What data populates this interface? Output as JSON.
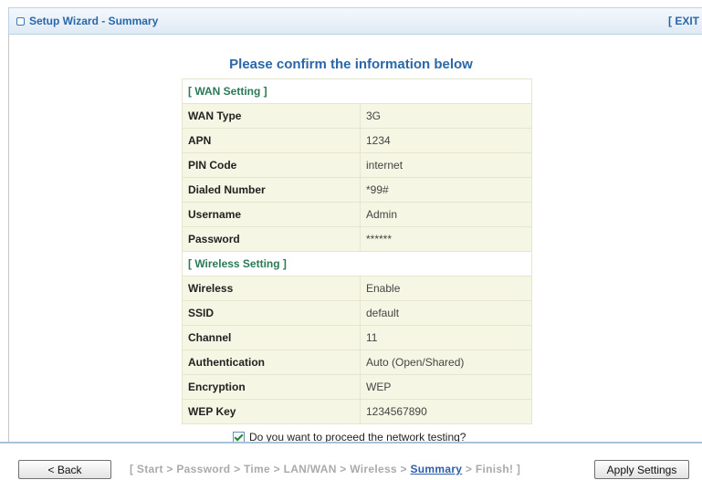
{
  "header": {
    "title": "Setup Wizard - Summary",
    "exit_label": "[ EXIT"
  },
  "heading": "Please confirm the information below",
  "wan_section": "[ WAN Setting ]",
  "wan_rows": [
    {
      "label": "WAN Type",
      "value": "3G"
    },
    {
      "label": "APN",
      "value": "1234"
    },
    {
      "label": "PIN Code",
      "value": "internet"
    },
    {
      "label": "Dialed Number",
      "value": "*99#"
    },
    {
      "label": "Username",
      "value": "Admin"
    },
    {
      "label": "Password",
      "value": "******"
    }
  ],
  "wireless_section": "[ Wireless Setting ]",
  "wireless_rows": [
    {
      "label": "Wireless",
      "value": "Enable"
    },
    {
      "label": "SSID",
      "value": "default"
    },
    {
      "label": "Channel",
      "value": "11"
    },
    {
      "label": "Authentication",
      "value": "Auto (Open/Shared)"
    },
    {
      "label": "Encryption",
      "value": "WEP"
    },
    {
      "label": "WEP Key",
      "value": "1234567890"
    }
  ],
  "confirm": {
    "label": "Do you want to proceed the network testing?",
    "checked": true
  },
  "footer": {
    "back_label": "< Back",
    "apply_label": "Apply Settings",
    "steps_before": "[ Start > Password > Time > LAN/WAN > Wireless > ",
    "steps_current": "Summary",
    "steps_after": " > Finish! ]"
  },
  "colors": {
    "accent": "#2a67a8",
    "section": "#2a7a55",
    "row_bg": "#f6f6e4"
  }
}
